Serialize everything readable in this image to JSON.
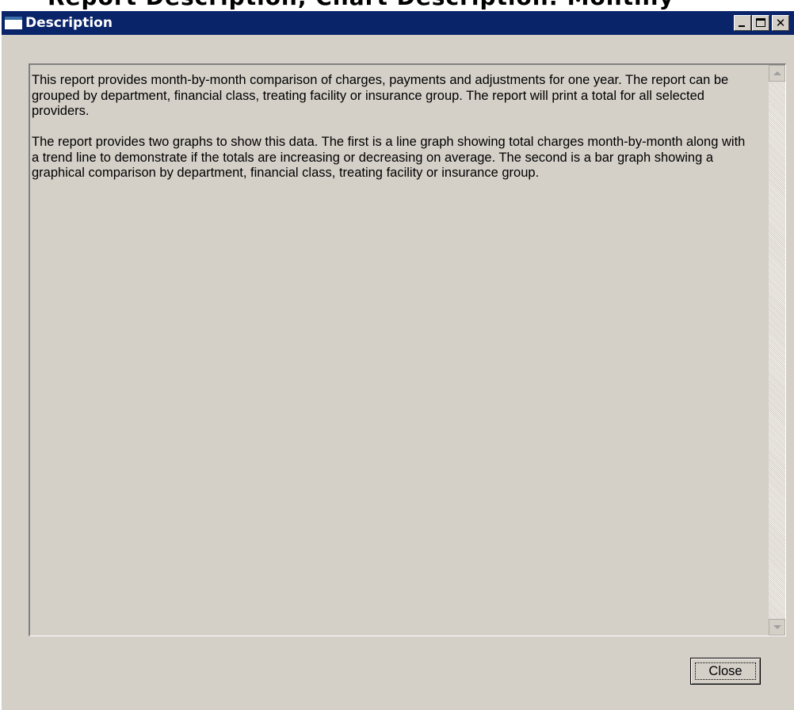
{
  "background_caption": "Report Description, Chart Description: Monthly",
  "window": {
    "title": "Description",
    "title_icon": "window-icon",
    "controls": {
      "minimize_icon": "minimize-icon",
      "maximize_icon": "maximize-icon",
      "close_icon": "close-icon",
      "close_glyph": "✕"
    }
  },
  "description": {
    "paragraphs": [
      "This report provides month-by-month comparison of charges, payments and adjustments for one year.  The report can be grouped by department, financial class, treating facility or insurance group.  The report will print a total for all selected providers.",
      "The report provides two graphs to show this data.  The first is a line graph showing total charges month-by-month along with a trend line to demonstrate if the totals are increasing or decreasing on average.  The second is a bar graph showing a graphical comparison by department, financial class, treating facility or insurance group."
    ]
  },
  "scrollbar": {
    "up_icon": "scroll-up-arrow-icon",
    "down_icon": "scroll-down-arrow-icon"
  },
  "buttons": {
    "close_label": "Close"
  },
  "colors": {
    "titlebar": "#0a246a",
    "window_face": "#d4d0c8",
    "title_text": "#ffffff"
  }
}
